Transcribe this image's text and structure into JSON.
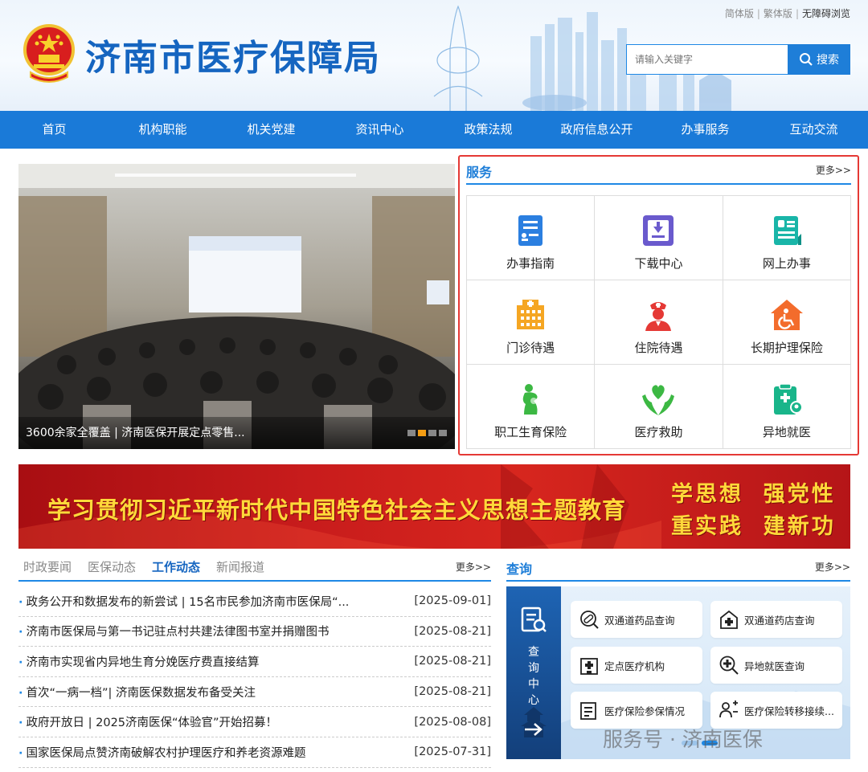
{
  "header": {
    "site_title": "济南市医疗保障局",
    "links": {
      "simplified": "简体版",
      "traditional": "繁体版",
      "accessible": "无障碍浏览"
    },
    "search_placeholder": "请输入关键字",
    "search_button": "搜索"
  },
  "nav": {
    "items": [
      {
        "label": "首页"
      },
      {
        "label": "机构职能"
      },
      {
        "label": "机关党建"
      },
      {
        "label": "资讯中心"
      },
      {
        "label": "政策法规"
      },
      {
        "label": "政府信息公开"
      },
      {
        "label": "办事服务"
      },
      {
        "label": "互动交流"
      }
    ]
  },
  "slider": {
    "caption": "3600余家全覆盖 | 济南医保开展定点零售...",
    "slide_count": 4,
    "active_index": 1
  },
  "service": {
    "title": "服务",
    "more": "更多>>",
    "items": [
      {
        "label": "办事指南",
        "icon": "guide-icon",
        "color": "#2b7fe0"
      },
      {
        "label": "下载中心",
        "icon": "download-icon",
        "color": "#6a5acd"
      },
      {
        "label": "网上办事",
        "icon": "online-service-icon",
        "color": "#19b5a8"
      },
      {
        "label": "门诊待遇",
        "icon": "clinic-icon",
        "color": "#f5a623"
      },
      {
        "label": "住院待遇",
        "icon": "nurse-icon",
        "color": "#e53935"
      },
      {
        "label": "长期护理保险",
        "icon": "wheelchair-icon",
        "color": "#f36c2c"
      },
      {
        "label": "职工生育保险",
        "icon": "maternity-icon",
        "color": "#3cb843"
      },
      {
        "label": "医疗救助",
        "icon": "heart-hands-icon",
        "color": "#3cb843"
      },
      {
        "label": "异地就医",
        "icon": "location-clipboard-icon",
        "color": "#19b58a"
      }
    ]
  },
  "banner": {
    "text": "学习贯彻习近平新时代中国特色社会主义思想主题教育",
    "slogan_line1": "学思想  强党性",
    "slogan_line2": "重实践  建新功"
  },
  "news": {
    "tabs": [
      {
        "label": "时政要闻",
        "active": false
      },
      {
        "label": "医保动态",
        "active": false
      },
      {
        "label": "工作动态",
        "active": true
      },
      {
        "label": "新闻报道",
        "active": false
      }
    ],
    "more": "更多>>",
    "items": [
      {
        "title": "政务公开和数据发布的新尝试 | 15名市民参加济南市医保局“...",
        "date": "[2025-09-01]"
      },
      {
        "title": "济南市医保局与第一书记驻点村共建法律图书室并捐赠图书",
        "date": "[2025-08-21]"
      },
      {
        "title": "济南市实现省内异地生育分娩医疗费直接结算",
        "date": "[2025-08-21]"
      },
      {
        "title": "首次“一病一档”| 济南医保数据发布备受关注",
        "date": "[2025-08-21]"
      },
      {
        "title": "政府开放日 | 2025济南医保“体验官”开始招募！",
        "date": "[2025-08-08]"
      },
      {
        "title": "国家医保局点赞济南破解农村护理医疗和养老资源难题",
        "date": "[2025-07-31]"
      }
    ]
  },
  "query": {
    "title": "查询",
    "more": "更多>>",
    "side_label": "查询中心",
    "buttons": [
      {
        "label": "双通道药品查询",
        "icon": "pill-search-icon"
      },
      {
        "label": "双通道药店查询",
        "icon": "pharmacy-icon"
      },
      {
        "label": "定点医疗机构",
        "icon": "hospital-building-icon"
      },
      {
        "label": "异地就医查询",
        "icon": "medical-search-icon"
      },
      {
        "label": "医疗保险参保情况",
        "icon": "insurance-record-icon"
      },
      {
        "label": "医疗保险转移接续...",
        "icon": "transfer-users-icon"
      }
    ],
    "slide_count": 2,
    "active_index": 1
  },
  "watermark": "服务号 · 济南医保"
}
